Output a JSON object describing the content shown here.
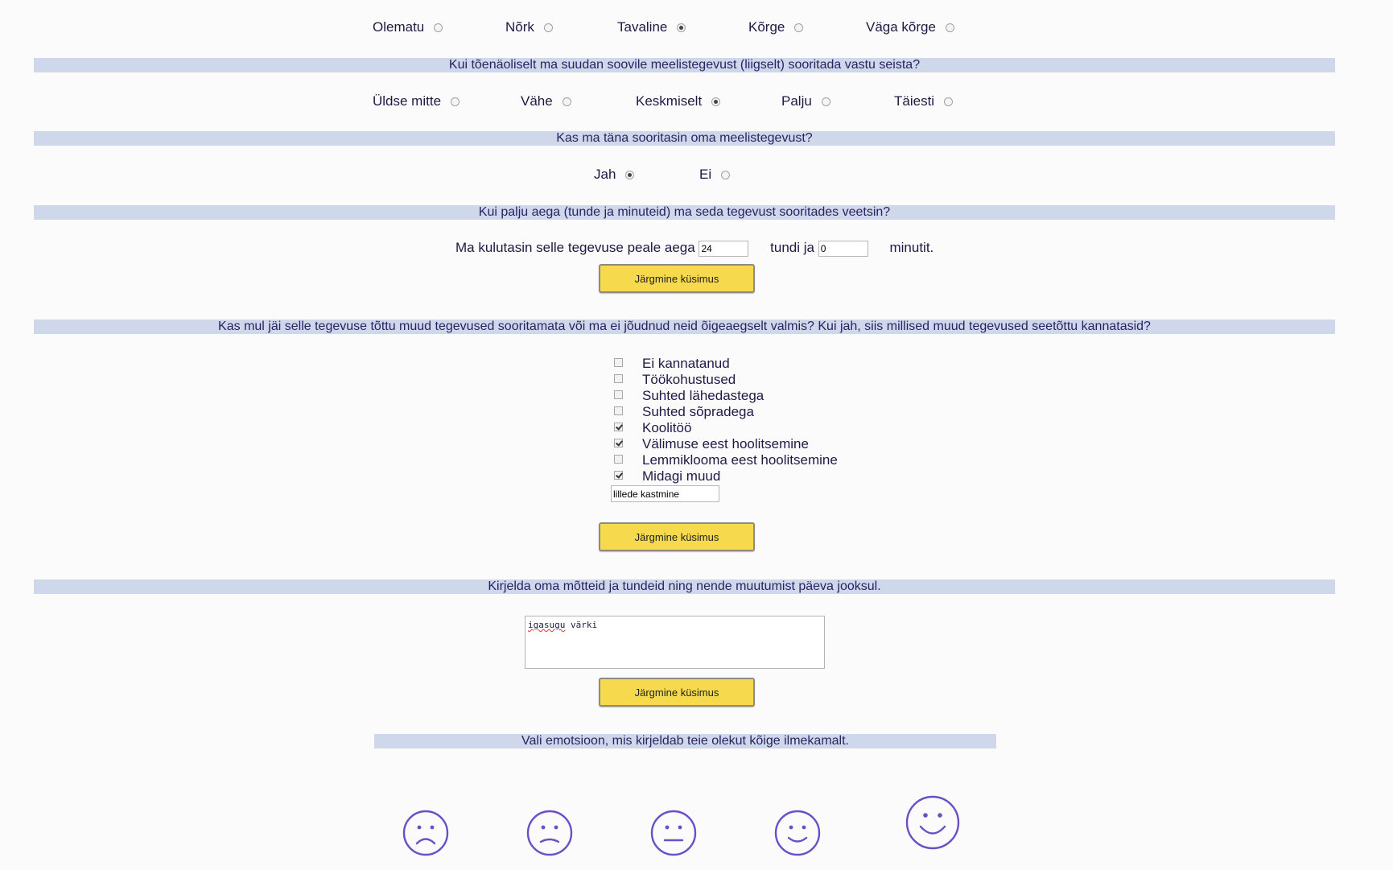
{
  "q_intensity": {
    "options": [
      {
        "label": "Olematu",
        "checked": false
      },
      {
        "label": "Nõrk",
        "checked": false
      },
      {
        "label": "Tavaline",
        "checked": true
      },
      {
        "label": "Kõrge",
        "checked": false
      },
      {
        "label": "Väga kõrge",
        "checked": false
      }
    ]
  },
  "q_resist": {
    "title": "Kui tõenäoliselt ma suudan soovile meelistegevust (liigselt) sooritada vastu seista?",
    "options": [
      {
        "label": "Üldse mitte",
        "checked": false
      },
      {
        "label": "Vähe",
        "checked": false
      },
      {
        "label": "Keskmiselt",
        "checked": true
      },
      {
        "label": "Palju",
        "checked": false
      },
      {
        "label": "Täiesti",
        "checked": false
      }
    ]
  },
  "q_performed": {
    "title": "Kas ma täna sooritasin oma meelistegevust?",
    "options": [
      {
        "label": "Jah",
        "checked": true
      },
      {
        "label": "Ei",
        "checked": false
      }
    ]
  },
  "q_time": {
    "title": "Kui palju aega (tunde ja minuteid) ma seda tegevust sooritades veetsin?",
    "prefix": "Ma kulutasin selle tegevuse peale aega",
    "hours_value": "24",
    "hours_suffix": "tundi ja",
    "minutes_value": "0",
    "minutes_suffix": "minutit.",
    "button": "Järgmine küsimus"
  },
  "q_neglected": {
    "title": "Kas mul jäi selle tegevuse tõttu muud tegevused sooritamata või ma ei jõudnud neid õigeaegselt valmis? Kui jah, siis millised muud tegevused seetõttu kannatasid?",
    "items": [
      {
        "label": "Ei kannatanud",
        "checked": false
      },
      {
        "label": "Töökohustused",
        "checked": false
      },
      {
        "label": "Suhted lähedastega",
        "checked": false
      },
      {
        "label": "Suhted sõpradega",
        "checked": false
      },
      {
        "label": "Koolitöö",
        "checked": true
      },
      {
        "label": "Välimuse eest hoolitsemine",
        "checked": true
      },
      {
        "label": "Lemmiklooma eest hoolitsemine",
        "checked": false
      },
      {
        "label": "Midagi muud",
        "checked": true
      }
    ],
    "other_value": "lillede kastmine",
    "button": "Järgmine küsimus"
  },
  "q_thoughts": {
    "title": "Kirjelda oma mõtteid ja tundeid ning nende muutumist päeva jooksul.",
    "text_word1": "igasugu",
    "text_rest": " värki",
    "button": "Järgmine küsimus"
  },
  "q_emotion": {
    "title": "Vali emotsioon, mis kirjeldab teie olekut kõige ilmekamalt.",
    "faces": [
      "very-sad-face-icon",
      "sad-face-icon",
      "neutral-face-icon",
      "happy-face-icon",
      "very-happy-face-icon"
    ],
    "selected_index": 4
  },
  "colors": {
    "accent_bar": "#cfd8ea",
    "button": "#f6d94c",
    "emoticon": "#6a4fc6"
  }
}
